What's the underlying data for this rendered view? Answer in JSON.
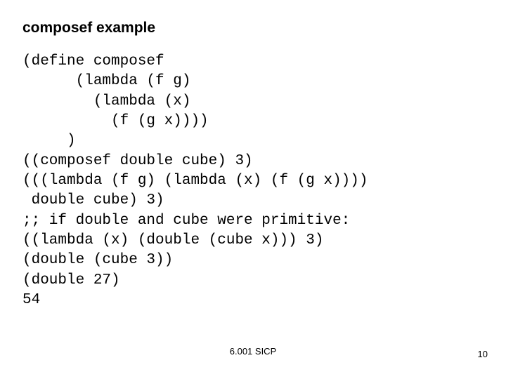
{
  "title": "composef example",
  "code": "(define composef\n      (lambda (f g)\n        (lambda (x)\n          (f (g x))))\n     )\n((composef double cube) 3)\n(((lambda (f g) (lambda (x) (f (g x))))\n double cube) 3)\n;; if double and cube were primitive:\n((lambda (x) (double (cube x))) 3)\n(double (cube 3))\n(double 27)\n54",
  "footer_center": "6.001 SICP",
  "page_number": "10"
}
